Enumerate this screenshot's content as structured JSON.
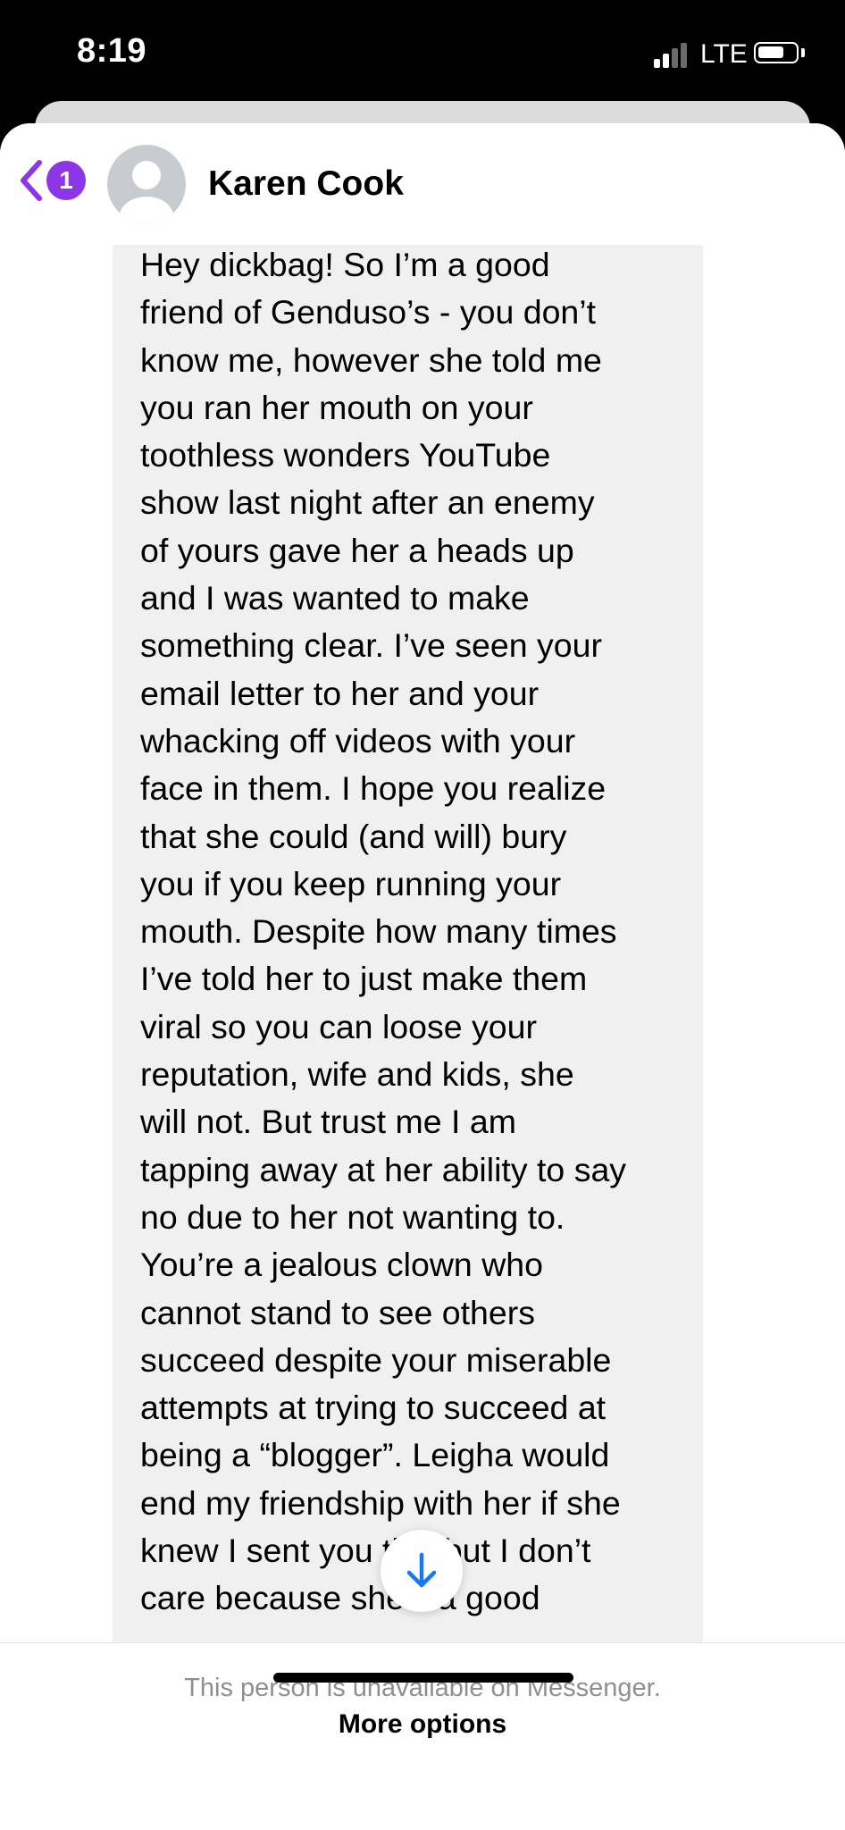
{
  "status_bar": {
    "time": "8:19",
    "carrier": "LTE"
  },
  "header": {
    "back_badge_count": "1",
    "contact_name": "Karen Cook"
  },
  "message": {
    "text": "Hey dickbag! So I’m a good\nfriend of Genduso’s - you don’t\nknow me, however she told me\nyou ran her mouth on your\ntoothless wonders YouTube\nshow last night after an enemy\nof yours gave her a heads up\nand I was wanted to make\nsomething clear.  I’ve seen your\nemail letter to her and your\nwhacking off videos with your\nface in them. I hope you realize\nthat she could (and will) bury\nyou if you keep running your\nmouth. Despite how many times\nI’ve told her to just make them\nviral so you can loose your\nreputation, wife and kids, she\nwill not. But trust me I am\ntapping away at her ability to say\nno due to her not wanting to.\nYou’re a jealous clown who\ncannot stand to see others\nsucceed despite your miserable\nattempts at trying to succeed at\nbeing a “blogger”. Leigha would\nend my friendship with her if she\nknew I sent you this but I don’t\ncare because she’s a good"
  },
  "footer": {
    "unavailable_text": "This person is unavailable on Messenger.",
    "more_options_label": "More options"
  },
  "colors": {
    "accent": "#8c36e8",
    "scroll_arrow": "#1877f2",
    "bubble": "#f0f0f0"
  },
  "icons": {
    "back": "chevron-left-icon",
    "scroll": "arrow-down-icon",
    "avatar": "default-avatar-icon"
  }
}
